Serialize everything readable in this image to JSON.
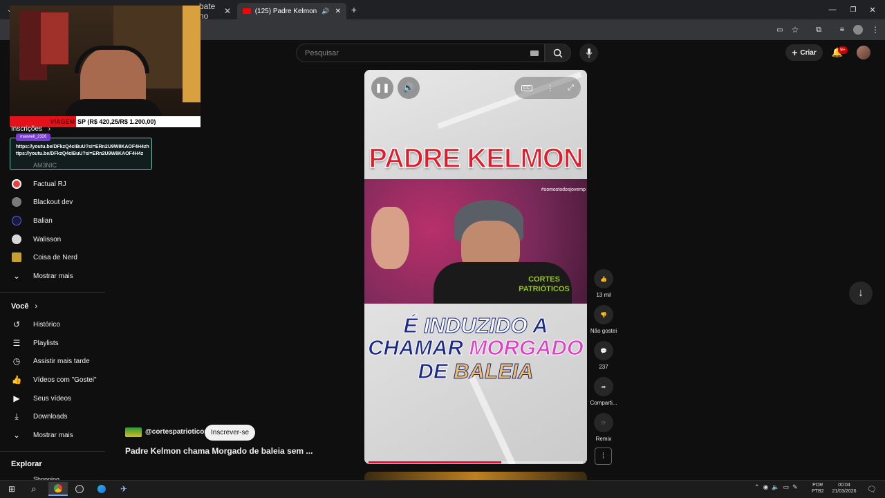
{
  "browser": {
    "tabs": [
      {
        "label": "bate no"
      },
      {
        "label": "(125) Padre Kelmon chama"
      }
    ],
    "new_tab": "+"
  },
  "header": {
    "search_placeholder": "Pesquisar",
    "create_label": "Criar",
    "notif_badge": "9+"
  },
  "overlay": {
    "ticker_left": "VIAGEM",
    "ticker_right": "SP (R$ 420,25/R$ 1.200,00)",
    "chat_user": "maxwell_2326",
    "chat_message": "https://youtu.be/DFkzQ4cIBuU?si=ERn2U9W8KAOF4H4zhttps://youtu.be/DFkzQ4cIBuU?si=ERn2U9W8KAOF4H4z"
  },
  "sidebar": {
    "subscriptions_title": "Inscrições",
    "hidden_item": "AM3NIC",
    "subs": [
      {
        "label": "Factual RJ"
      },
      {
        "label": "Blackout dev"
      },
      {
        "label": "Balian"
      },
      {
        "label": "Walisson"
      },
      {
        "label": "Coisa de Nerd"
      },
      {
        "label": "Mostrar mais"
      }
    ],
    "you_title": "Você",
    "you_items": [
      {
        "label": "Histórico"
      },
      {
        "label": "Playlists"
      },
      {
        "label": "Assistir mais tarde"
      },
      {
        "label": "Vídeos com \"Gostei\""
      },
      {
        "label": "Seus vídeos"
      },
      {
        "label": "Downloads"
      },
      {
        "label": "Mostrar mais"
      }
    ],
    "explore_title": "Explorar",
    "explore_partial": "Shopping"
  },
  "video": {
    "title_overlay": "PADRE KELMON",
    "hashtag": "#somostodosjovemp",
    "caption_line1_a": "É",
    "caption_line1_b": "INDUZIDO",
    "caption_line1_c": "A",
    "caption_line2_a": "CHAMAR",
    "caption_line2_b": "MORGADO",
    "caption_line3_a": "DE",
    "caption_line3_b": "BALEIA",
    "logo_text": "CORTES PATRIÓTICOS",
    "progress": 0.62
  },
  "channel": {
    "handle": "@cortespatrioticos",
    "subscribe_label": "Inscrever-se",
    "video_title": "Padre Kelmon chama Morgado de baleia sem ..."
  },
  "actions": {
    "like_count": "13 mil",
    "dislike_label": "Não gostei",
    "comments_count": "237",
    "share_label": "Comparti...",
    "remix_label": "Remix"
  },
  "taskbar": {
    "lang_top": "POR",
    "lang_bottom": "PTB2",
    "time": "00:04",
    "date": "21/03/2026"
  },
  "colors": {
    "accent_red": "#ff0000",
    "caption_blue": "#1b2a8a",
    "caption_pink": "#e040c8",
    "caption_gold": "#f3c063"
  }
}
